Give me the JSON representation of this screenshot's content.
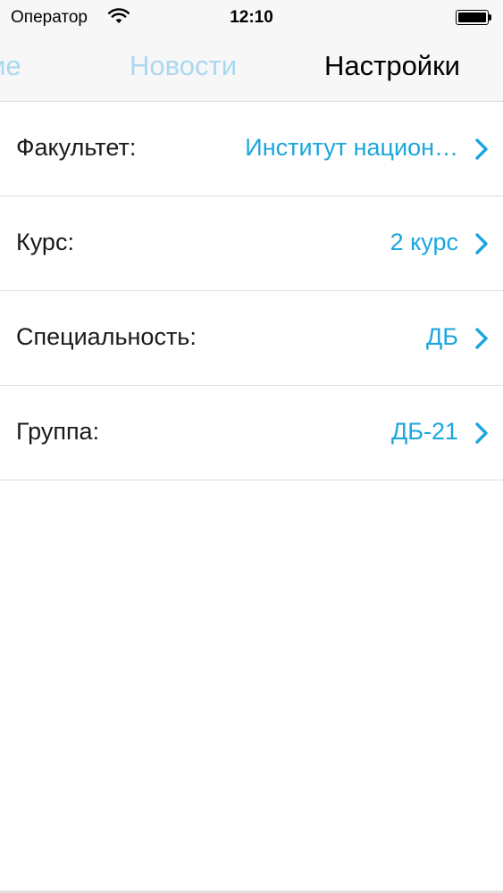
{
  "status_bar": {
    "carrier": "Оператор",
    "time": "12:10"
  },
  "tabs": [
    {
      "label": "ние",
      "active": false
    },
    {
      "label": "Новости",
      "active": false
    },
    {
      "label": "Настройки",
      "active": true
    }
  ],
  "settings": [
    {
      "label": "Факультет:",
      "value": "Институт национ…"
    },
    {
      "label": "Курс:",
      "value": "2 курс"
    },
    {
      "label": "Специальность:",
      "value": "ДБ"
    },
    {
      "label": "Группа:",
      "value": "ДБ-21"
    }
  ],
  "colors": {
    "accent": "#1ba6dd",
    "inactive_tab": "#a9d8ef",
    "header_bg": "#f7f7f8"
  }
}
